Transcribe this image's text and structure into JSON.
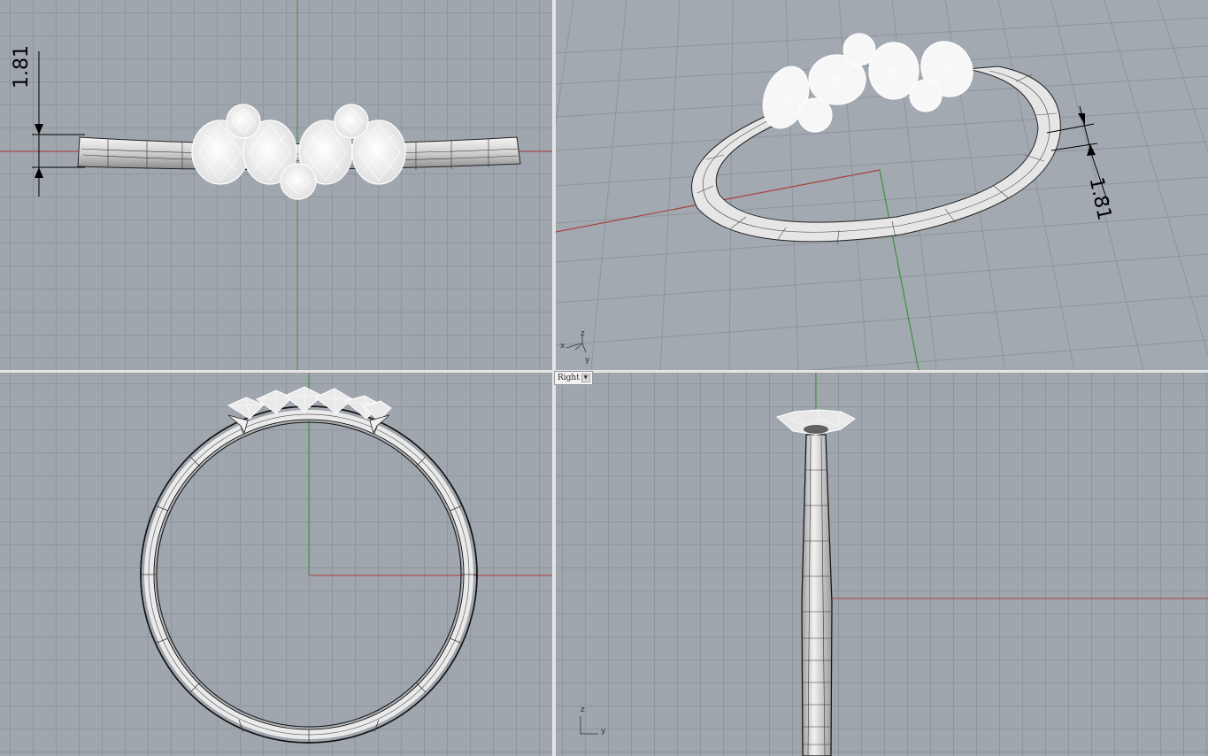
{
  "viewports": {
    "front": {
      "dimension": "1.81"
    },
    "perspective": {
      "dimension": "1.81",
      "axes": {
        "x": "x",
        "y": "y",
        "z": "z"
      }
    },
    "top": {},
    "right": {
      "title": "Right",
      "axes": {
        "y": "y",
        "z": "z"
      }
    }
  },
  "colors": {
    "viewport_bg": "#a0a6ad",
    "grid": "#8f959c",
    "x_axis": "#a84040",
    "y_axis": "#3f8f3f",
    "ring_fill": "#e8e8e8",
    "gem_outline": "#ffffff"
  },
  "icons": {
    "dropdown": "chevron-down-icon"
  }
}
